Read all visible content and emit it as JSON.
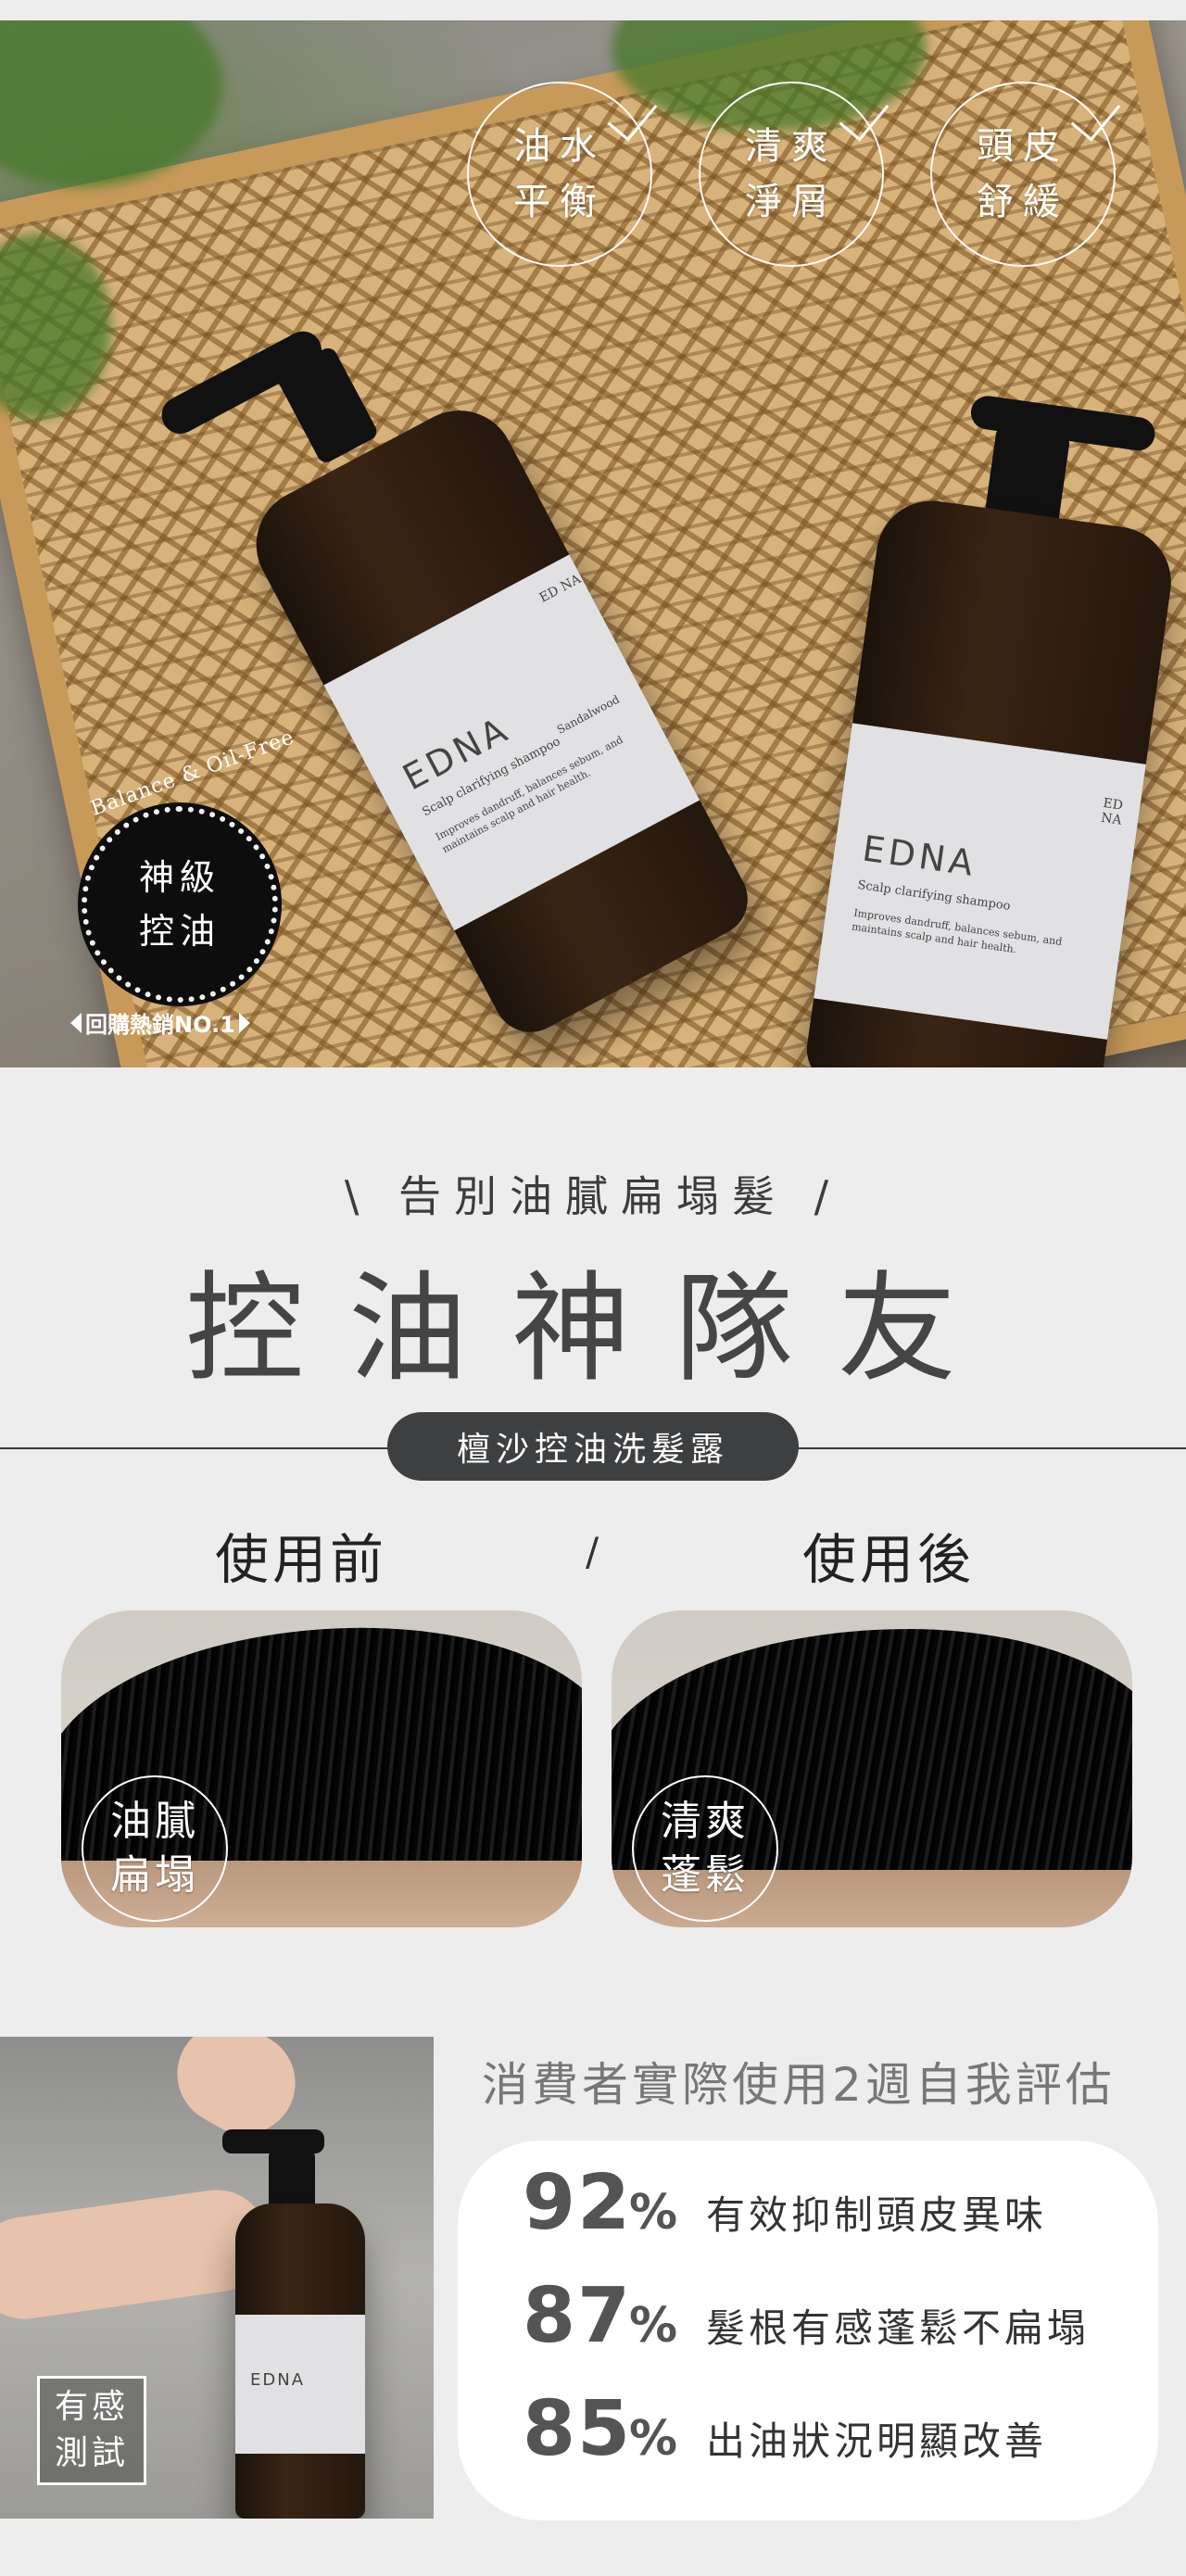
{
  "hero": {
    "badges": [
      {
        "line1": "油水",
        "line2": "平衡"
      },
      {
        "line1": "清爽",
        "line2": "淨屑"
      },
      {
        "line1": "頭皮",
        "line2": "舒緩"
      }
    ],
    "seal": {
      "arc": "Balance & Oil-Free",
      "line1": "神級",
      "line2": "控油"
    },
    "rebuy": "回購熱銷NO.1",
    "bottle_brand": "EDNA",
    "bottle_logo": "ED NA",
    "bottle_subtitle": "Scalp clarifying shampoo",
    "bottle_desc": "Improves dandruff, balances sebum, and maintains scalp and hair health.",
    "bottle_scent": "Sandalwood"
  },
  "headline": {
    "sub": "\\ 告別油膩扁塌髮 /",
    "main": "控油神隊友",
    "product": "檀沙控油洗髮露"
  },
  "comparison": {
    "before": {
      "label": "使用前",
      "badge_line1": "油膩",
      "badge_line2": "扁塌"
    },
    "separator": "/",
    "after": {
      "label": "使用後",
      "badge_line1": "清爽",
      "badge_line2": "蓬鬆"
    }
  },
  "test": {
    "badge_line1": "有感",
    "badge_line2": "測試",
    "survey_title": "消費者實際使用2週自我評估",
    "stats": [
      {
        "value": "92",
        "unit": "%",
        "text": "有效抑制頭皮異味"
      },
      {
        "value": "87",
        "unit": "%",
        "text": "髮根有感蓬鬆不扁塌"
      },
      {
        "value": "85",
        "unit": "%",
        "text": "出油狀況明顯改善"
      }
    ]
  }
}
